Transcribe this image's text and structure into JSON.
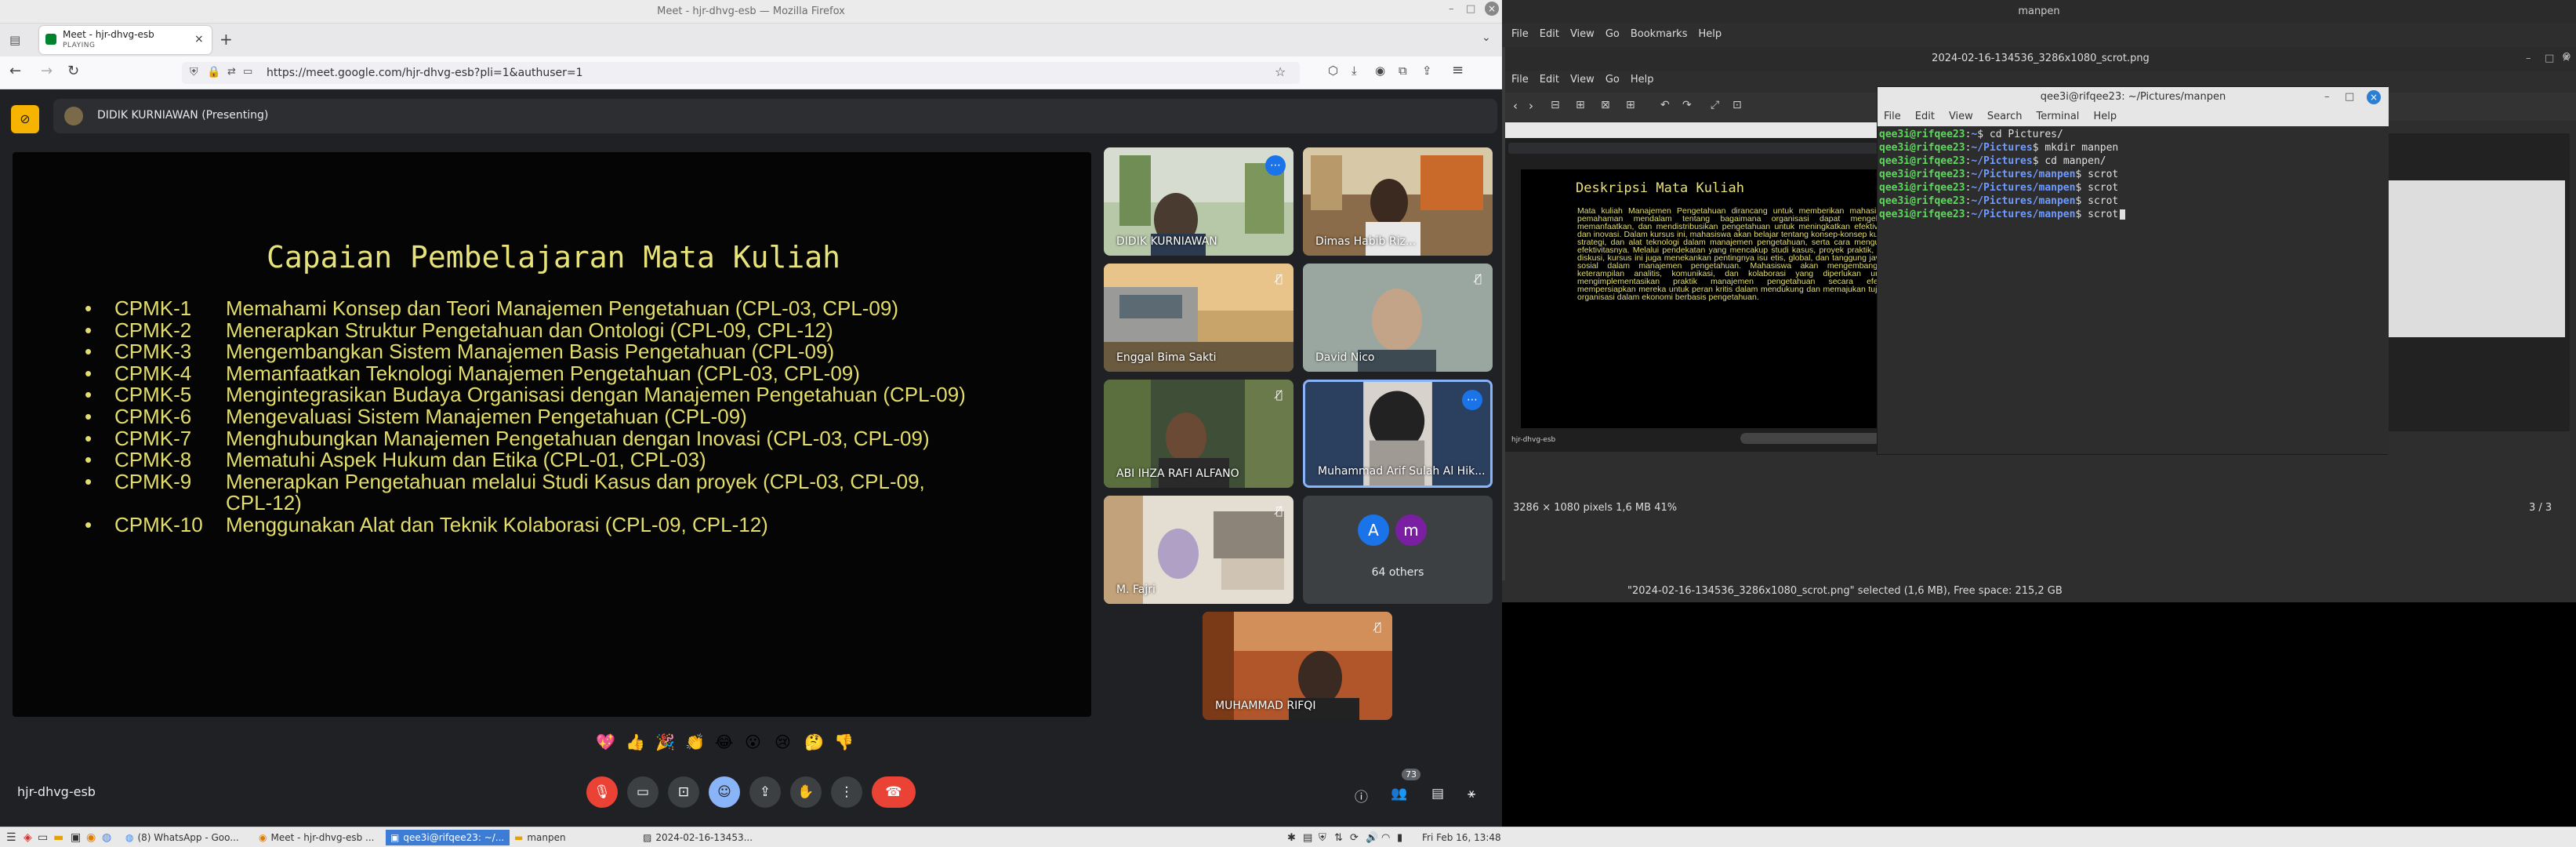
{
  "firefox": {
    "title": "Meet - hjr-dhvg-esb — Mozilla Firefox",
    "tab_title": "Meet - hjr-dhvg-esb",
    "tab_subtitle": "PLAYING",
    "url": "https://meet.google.com/hjr-dhvg-esb?pli=1&authuser=1"
  },
  "meet": {
    "presenter_label": "DIDIK KURNIAWAN (Presenting)",
    "meeting_code": "hjr-dhvg-esb",
    "others_count": "64 others",
    "people_badge": "73",
    "avatar_letters": [
      "A",
      "m"
    ],
    "reactions": [
      "💖",
      "👍",
      "🎉",
      "👏",
      "😂",
      "😮",
      "😢",
      "🤔",
      "👎"
    ],
    "participants": [
      "DIDIK KURNIAWAN",
      "Dimas Habib Riz...",
      "Enggal Bima Sakti",
      "David Nico",
      "ABI IHZA RAFI ALFANO",
      "Muhammad Arif Sulah Al Hik...",
      "M. Fajri",
      "MUHAMMAD RIFQI"
    ]
  },
  "slide": {
    "title": "Capaian Pembelajaran Mata Kuliah",
    "items": [
      {
        "code": "CPMK-1",
        "text": "Memahami Konsep dan Teori Manajemen Pengetahuan (CPL-03, CPL-09)"
      },
      {
        "code": "CPMK-2",
        "text": "Menerapkan Struktur Pengetahuan dan Ontologi (CPL-09, CPL-12)"
      },
      {
        "code": "CPMK-3",
        "text": "Mengembangkan Sistem Manajemen Basis Pengetahuan (CPL-09)"
      },
      {
        "code": "CPMK-4",
        "text": "Memanfaatkan Teknologi Manajemen Pengetahuan (CPL-03, CPL-09)"
      },
      {
        "code": "CPMK-5",
        "text": "Mengintegrasikan Budaya Organisasi dengan Manajemen Pengetahuan (CPL-09)"
      },
      {
        "code": "CPMK-6",
        "text": "Mengevaluasi Sistem Manajemen Pengetahuan (CPL-09)"
      },
      {
        "code": "CPMK-7",
        "text": "Menghubungkan Manajemen Pengetahuan dengan Inovasi (CPL-03, CPL-09)"
      },
      {
        "code": "CPMK-8",
        "text": "Mematuhi Aspek Hukum dan Etika (CPL-01, CPL-03)"
      },
      {
        "code": "CPMK-9",
        "text": "Menerapkan Pengetahuan melalui Studi Kasus dan proyek (CPL-03, CPL-09,"
      },
      {
        "code": "",
        "text": "CPL-12)"
      },
      {
        "code": "CPMK-10",
        "text": "Menggunakan Alat dan Teknik Kolaborasi (CPL-09, CPL-12)"
      }
    ]
  },
  "viewer": {
    "outer_title": "manpen",
    "inner_title": "2024-02-16-134536_3286x1080_scrot.png",
    "menu": [
      "File",
      "Edit",
      "View",
      "Go",
      "Bookmarks",
      "Help"
    ],
    "inner_menu": [
      "File",
      "Edit",
      "View",
      "Go",
      "Help"
    ],
    "info": "3286 × 1080 pixels  1,6 MB   41%",
    "page": "3 / 3",
    "statusbar": "\"2024-02-16-134536_3286x1080_scrot.png\" selected (1,6 MB), Free space: 215,2 GB",
    "mini_heading": "Deskripsi Mata Kuliah",
    "mini_text": "Mata kuliah Manajemen Pengetahuan dirancang untuk memberikan mahasiswa pemahaman mendalam tentang bagaimana organisasi dapat mengelola, memanfaatkan, dan mendistribusikan pengetahuan untuk meningkatkan efektivitas dan inovasi. Dalam kursus ini, mahasiswa akan belajar tentang konsep-konsep kunci, strategi, dan alat teknologi dalam manajemen pengetahuan, serta cara mengukur efektivitasnya. Melalui pendekatan yang mencakup studi kasus, proyek praktik, dan diskusi, kursus ini juga menekankan pentingnya isu etis, global, dan tanggung jawab sosial dalam manajemen pengetahuan. Mahasiswa akan mengembangkan keterampilan analitis, komunikasi, dan kolaborasi yang diperlukan untuk mengimplementasikan praktik manajemen pengetahuan secara efektif, mempersiapkan mereka untuk peran kritis dalam mendukung dan memajukan tujuan organisasi dalam ekonomi berbasis pengetahuan.",
    "mini_code": "hjr-dhvg-esb"
  },
  "terminal": {
    "title": "qee3i@rifqee23: ~/Pictures/manpen",
    "menu": [
      "File",
      "Edit",
      "View",
      "Search",
      "Terminal",
      "Help"
    ],
    "lines": [
      {
        "prompt": "qee3i@rifqee23",
        "path": "~",
        "cmd": "$ cd Pictures/"
      },
      {
        "prompt": "qee3i@rifqee23",
        "path": "~/Pictures",
        "cmd": "$ mkdir manpen"
      },
      {
        "prompt": "qee3i@rifqee23",
        "path": "~/Pictures",
        "cmd": "$ cd manpen/"
      },
      {
        "prompt": "qee3i@rifqee23",
        "path": "~/Pictures/manpen",
        "cmd": "$ scrot"
      },
      {
        "prompt": "qee3i@rifqee23",
        "path": "~/Pictures/manpen",
        "cmd": "$ scrot"
      },
      {
        "prompt": "qee3i@rifqee23",
        "path": "~/Pictures/manpen",
        "cmd": "$ scrot"
      },
      {
        "prompt": "qee3i@rifqee23",
        "path": "~/Pictures/manpen",
        "cmd": "$ scrot"
      }
    ]
  },
  "taskbar": {
    "items": [
      "(8) WhatsApp - Goo...",
      "Meet - hjr-dhvg-esb ...",
      "qee3i@rifqee23: ~/...",
      "manpen",
      "2024-02-16-13453..."
    ],
    "clock": "Fri Feb 16, 13:48"
  }
}
